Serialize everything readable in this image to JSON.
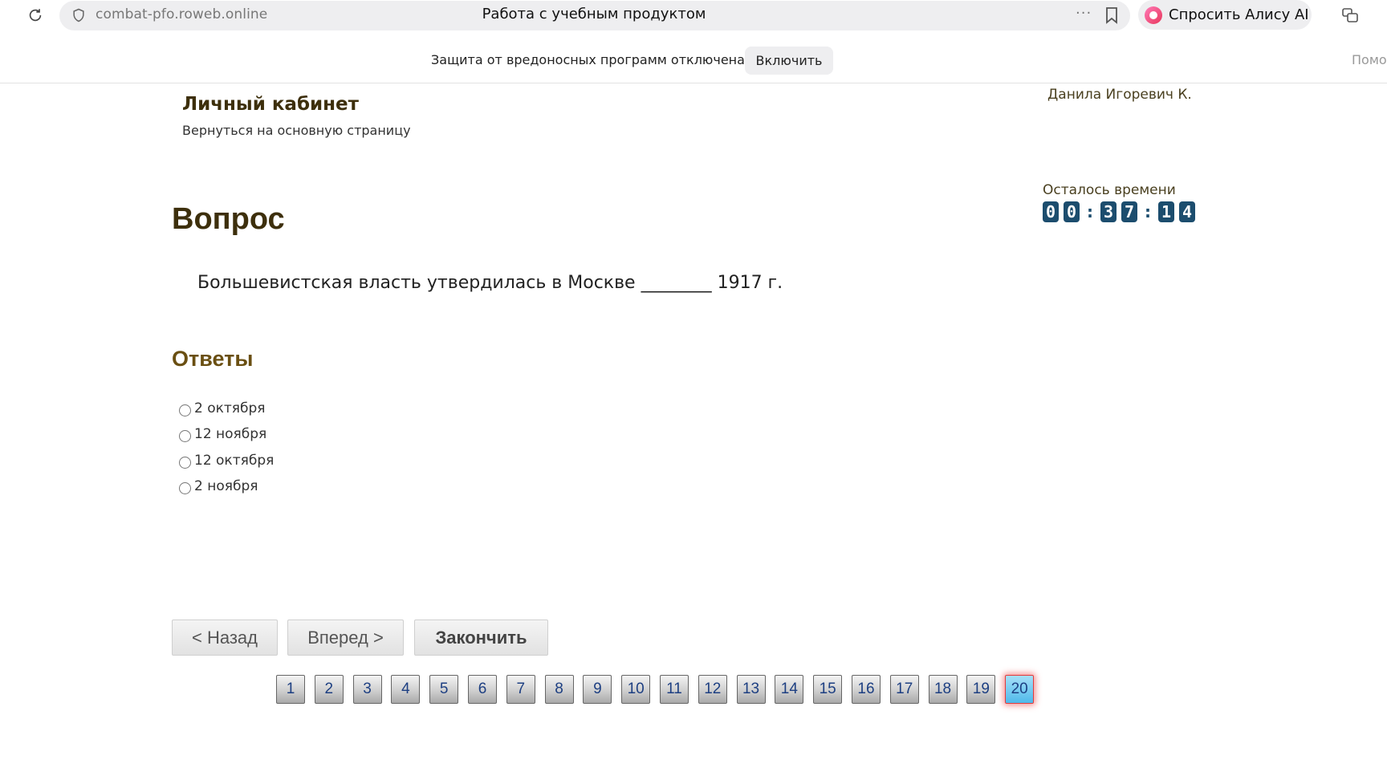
{
  "browser": {
    "url": "combat-pfo.roweb.online",
    "tab_title": "Работа с учебным продуктом",
    "more": "···",
    "alice_label": "Спросить Алису AI"
  },
  "infobar": {
    "message": "Защита от вредоносных программ отключена",
    "enable_label": "Включить",
    "help_label": "Помо"
  },
  "header": {
    "cabinet_title": "Личный кабинет",
    "back_link": "Вернуться на основную страницу",
    "user_name": "Данила Игоревич К."
  },
  "timer": {
    "label": "Осталось времени",
    "digits": [
      "0",
      "0",
      "3",
      "7",
      "1",
      "4"
    ],
    "separator": ":"
  },
  "question": {
    "heading": "Вопрос",
    "text": "Большевистская власть утвердилась в Москве ________ 1917 г."
  },
  "answers": {
    "heading": "Ответы",
    "options": [
      "2 октября",
      "12 ноября",
      "12 октября",
      "2 ноября"
    ]
  },
  "navigation": {
    "back_label": "< Назад",
    "forward_label": "Вперед >",
    "finish_label": "Закончить"
  },
  "pager": {
    "pages": [
      "1",
      "2",
      "3",
      "4",
      "5",
      "6",
      "7",
      "8",
      "9",
      "10",
      "11",
      "12",
      "13",
      "14",
      "15",
      "16",
      "17",
      "18",
      "19",
      "20"
    ],
    "current": "20"
  },
  "colors": {
    "heading": "#3d2f0c",
    "answers_heading": "#6a4f12",
    "timer_digit_bg": "#1c4d6e",
    "active_page_border": "#e53a3a",
    "active_page_bg": "#4fb9ea"
  }
}
